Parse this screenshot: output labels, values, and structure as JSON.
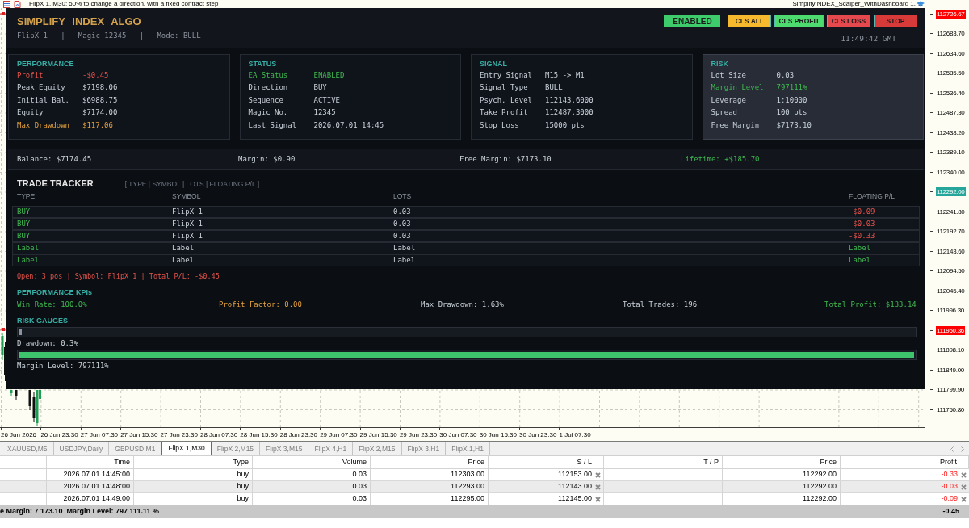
{
  "chart": {
    "title": "FlipX 1, M30: 50% to change a direction, with a fixed contract step",
    "expert": "SimplifyINDEX_Scalper_WithDashboard 1.",
    "price_axis": [
      {
        "label": "112726.67",
        "kind": "tag",
        "color": "#ff0000"
      },
      {
        "label": "112683.70",
        "kind": "tick"
      },
      {
        "label": "112634.60",
        "kind": "tick"
      },
      {
        "label": "112585.50",
        "kind": "tick"
      },
      {
        "label": "112536.40",
        "kind": "tick"
      },
      {
        "label": "112487.30",
        "kind": "tick"
      },
      {
        "label": "112438.20",
        "kind": "tick"
      },
      {
        "label": "112389.10",
        "kind": "tick"
      },
      {
        "label": "112340.00",
        "kind": "tick"
      },
      {
        "label": "112292.00",
        "kind": "tag",
        "color": "#26a69a"
      },
      {
        "label": "112241.80",
        "kind": "tick"
      },
      {
        "label": "112192.70",
        "kind": "tick"
      },
      {
        "label": "112143.60",
        "kind": "tick"
      },
      {
        "label": "112094.50",
        "kind": "tick"
      },
      {
        "label": "112045.40",
        "kind": "tick"
      },
      {
        "label": "111996.30",
        "kind": "tick"
      },
      {
        "label": "111950.36",
        "kind": "tag",
        "color": "#ff0000"
      },
      {
        "label": "111898.10",
        "kind": "tick"
      },
      {
        "label": "111849.00",
        "kind": "tick"
      },
      {
        "label": "111799.90",
        "kind": "tick"
      },
      {
        "label": "111750.80",
        "kind": "tick"
      }
    ],
    "time_axis": [
      "26 Jun 2026",
      "26 Jun 23:30",
      "27 Jun 07:30",
      "27 Jun 15:30",
      "27 Jun 23:30",
      "28 Jun 07:30",
      "28 Jun 15:30",
      "28 Jun 23:30",
      "29 Jun 07:30",
      "29 Jun 15:30",
      "29 Jun 23:30",
      "30 Jun 07:30",
      "30 Jun 15:30",
      "30 Jun 23:30",
      "1 Jul 07:30"
    ]
  },
  "dashboard": {
    "title": "SIMPLIFY INDEX ALGO",
    "subtitle": "FlipX 1   |   Magic 12345   |   Mode: BULL",
    "buttons": [
      {
        "label": "ENABLED",
        "kind": "status",
        "color": "#3ecb6c"
      },
      {
        "label": "CLS ALL",
        "kind": "action",
        "color": "#f6b82c"
      },
      {
        "label": "CLS PROFIT",
        "kind": "action",
        "color": "#4ddb6f"
      },
      {
        "label": "CLS LOSS",
        "kind": "action",
        "color": "#e5484d"
      },
      {
        "label": "STOP",
        "kind": "action",
        "color": "#d83a3a"
      }
    ],
    "clock": "11:49:42 GMT",
    "cards": [
      {
        "title": "PERFORMANCE",
        "highlighted": false,
        "rows": [
          {
            "label": "Profit",
            "value": "-$0.45",
            "kind": "loss"
          },
          {
            "label": "Peak Equity",
            "value": "$7198.06",
            "kind": "plain"
          },
          {
            "label": "Initial Bal.",
            "value": "$6988.75",
            "kind": "plain"
          },
          {
            "label": "Equity",
            "value": "$7174.00",
            "kind": "plain"
          },
          {
            "label": "Max Drawdown",
            "value": "$117.06",
            "kind": "warning"
          }
        ]
      },
      {
        "title": "STATUS",
        "highlighted": false,
        "rows": [
          {
            "label": "EA Status",
            "value": "ENABLED",
            "kind": "gain"
          },
          {
            "label": "Direction",
            "value": "BUY",
            "kind": "plain"
          },
          {
            "label": "Sequence",
            "value": "ACTIVE",
            "kind": "plain"
          },
          {
            "label": "Magic No.",
            "value": "12345",
            "kind": "plain"
          },
          {
            "label": "Last Signal",
            "value": "2026.07.01 14:45",
            "kind": "plain"
          }
        ]
      },
      {
        "title": "SIGNAL",
        "highlighted": false,
        "rows": [
          {
            "label": "Entry Signal",
            "value": "M15 -> M1",
            "kind": "plain"
          },
          {
            "label": "Signal Type",
            "value": "BULL",
            "kind": "plain"
          },
          {
            "label": "Psych. Level",
            "value": "112143.6000",
            "kind": "plain"
          },
          {
            "label": "Take Profit",
            "value": "112487.3000",
            "kind": "plain"
          },
          {
            "label": "Stop Loss",
            "value": "15000 pts",
            "kind": "plain"
          }
        ]
      },
      {
        "title": "RISK",
        "highlighted": true,
        "rows": [
          {
            "label": "Lot Size",
            "value": "0.03",
            "kind": "plain"
          },
          {
            "label": "Margin Level",
            "value": "797111%",
            "kind": "gain"
          },
          {
            "label": "Leverage",
            "value": "1:10000",
            "kind": "plain"
          },
          {
            "label": "Spread",
            "value": "100 pts",
            "kind": "plain"
          },
          {
            "label": "Free Margin",
            "value": "$7173.10",
            "kind": "plain"
          }
        ]
      }
    ],
    "summary": [
      {
        "text": "Balance: $7174.45",
        "kind": "plain"
      },
      {
        "text": "Margin: $0.90",
        "kind": "plain"
      },
      {
        "text": "Free Margin: $7173.10",
        "kind": "plain"
      },
      {
        "text": "Lifetime: +$185.70",
        "kind": "gain"
      }
    ],
    "trade_tracker": {
      "title": "TRADE TRACKER",
      "legend": "[ TYPE | SYMBOL | LOTS | FLOATING P/L ]",
      "columns": [
        "TYPE",
        "SYMBOL",
        "LOTS",
        "FLOATING P/L"
      ],
      "rows": [
        {
          "type": "BUY",
          "symbol": "FlipX 1",
          "lots": "0.03",
          "pnl": "-$0.09",
          "kind": "loss"
        },
        {
          "type": "BUY",
          "symbol": "FlipX 1",
          "lots": "0.03",
          "pnl": "-$0.03",
          "kind": "loss"
        },
        {
          "type": "BUY",
          "symbol": "FlipX 1",
          "lots": "0.03",
          "pnl": "-$0.33",
          "kind": "loss"
        },
        {
          "type": "Label",
          "symbol": "Label",
          "lots": "Label",
          "pnl": "Label",
          "kind": "gain"
        },
        {
          "type": "Label",
          "symbol": "Label",
          "lots": "Label",
          "pnl": "Label",
          "kind": "gain"
        }
      ],
      "footer": "Open: 3 pos | Symbol: FlipX 1 | Total P/L: -$0.45"
    },
    "kpis": {
      "title": "PERFORMANCE KPIs",
      "items": [
        {
          "text": "Win Rate: 100.0%",
          "kind": "gain"
        },
        {
          "text": "Profit Factor: 0.00",
          "kind": "warning"
        },
        {
          "text": "Max Drawdown: 1.63%",
          "kind": "plain"
        },
        {
          "text": "Total Trades: 196",
          "kind": "plain"
        },
        {
          "text": "Total Profit: $133.14",
          "kind": "gain"
        }
      ]
    },
    "risk_gauges": {
      "title": "RISK GAUGES",
      "gauges": [
        {
          "label": "Drawdown: 0.3%",
          "level": 0.003,
          "color": "#8b949e"
        },
        {
          "label": "Margin Level: 797111%",
          "level": 1,
          "color": "#3ec46d"
        }
      ]
    }
  },
  "tabs": [
    {
      "label": "XAUUSD,M5",
      "selected": false
    },
    {
      "label": "USDJPY,Daily",
      "selected": false
    },
    {
      "label": "GBPUSD,M1",
      "selected": false
    },
    {
      "label": "FlipX 1,M30",
      "selected": true
    },
    {
      "label": "FlipX 2,M15",
      "selected": false
    },
    {
      "label": "FlipX 3,M15",
      "selected": false
    },
    {
      "label": "FlipX 4,H1",
      "selected": false
    },
    {
      "label": "FlipX 2,M15",
      "selected": false
    },
    {
      "label": "FlipX 3,H1",
      "selected": false
    },
    {
      "label": "FlipX 1,H1",
      "selected": false
    }
  ],
  "trades_table": {
    "columns": [
      "Time",
      "Type",
      "Volume",
      "Price",
      "S / L",
      "T / P",
      "Price",
      "Profit"
    ],
    "rows": [
      {
        "time": "2026.07.01 14:45:00",
        "type": "buy",
        "volume": "0.03",
        "price": "112303.00",
        "sl": "112153.00",
        "current_price": "112292.00",
        "profit": "-0.33"
      },
      {
        "time": "2026.07.01 14:48:00",
        "type": "buy",
        "volume": "0.03",
        "price": "112293.00",
        "sl": "112143.00",
        "current_price": "112292.00",
        "profit": "-0.03"
      },
      {
        "time": "2026.07.01 14:49:00",
        "type": "buy",
        "volume": "0.03",
        "price": "112295.00",
        "sl": "112145.00",
        "current_price": "112292.00",
        "profit": "-0.09"
      }
    ],
    "footer": {
      "summary": "e Margin: 7 173.10  Margin Level: 797 111.11 %",
      "total": "-0.45"
    }
  }
}
